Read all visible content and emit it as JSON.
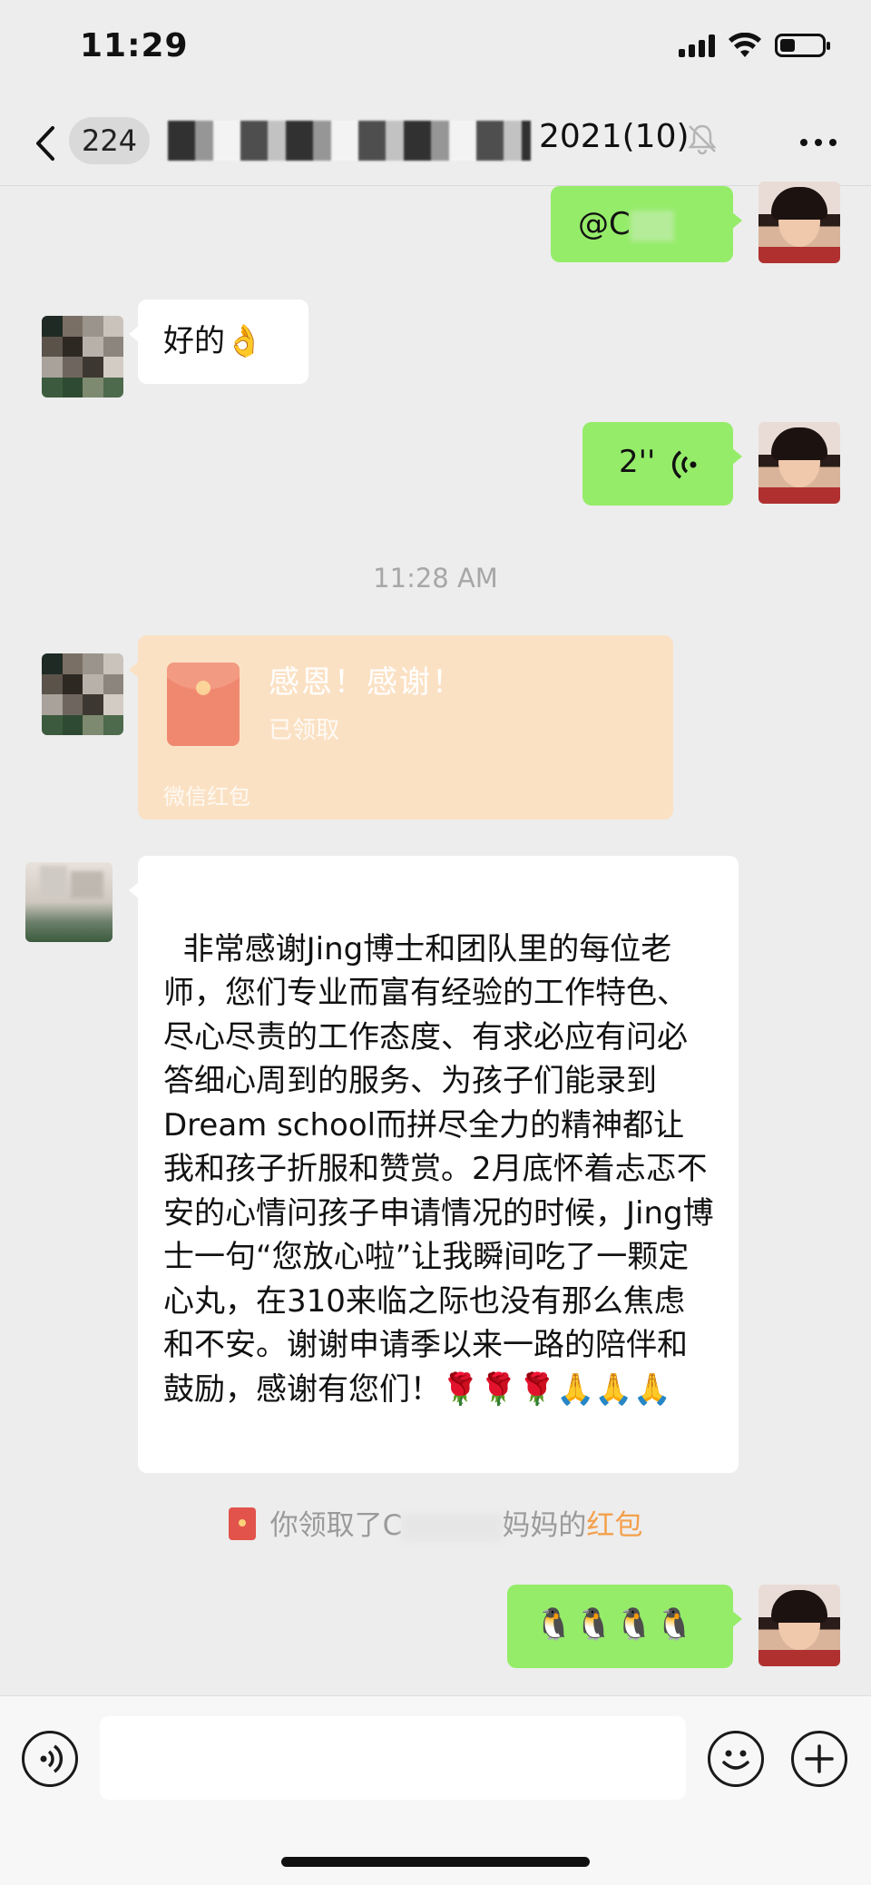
{
  "status_bar": {
    "time": "11:29"
  },
  "nav": {
    "unread_count": "224",
    "title": "2021(10)"
  },
  "messages": [
    {
      "sender": "me",
      "type": "text",
      "text": "@C"
    },
    {
      "sender": "other",
      "type": "text",
      "text": "好的👌"
    },
    {
      "sender": "me",
      "type": "voice",
      "duration": "2''"
    }
  ],
  "time_divider": "11:28 AM",
  "red_packet": {
    "greeting": "感恩！感谢！",
    "status": "已领取",
    "footer": "微信红包"
  },
  "long_message": {
    "text": "非常感谢Jing博士和团队里的每位老师，您们专业而富有经验的工作特色、尽心尽责的工作态度、有求必应有问必答细心周到的服务、为孩子们能录到Dream school而拼尽全力的精神都让我和孩子折服和赞赏。2月底怀着忐忑不安的心情问孩子申请情况的时候，Jing博士一句“您放心啦”让我瞬间吃了一颗定心丸，在310来临之际也没有那么焦虑和不安。谢谢申请季以来一路的陪伴和鼓励，感谢有您们！🌹🌹🌹🙏🙏🙏"
  },
  "system_note": {
    "prefix": "你领取了C",
    "suffix": "妈妈的",
    "link": "红包"
  },
  "last_message": {
    "sender": "me",
    "text": "🐧🐧🐧🐧"
  },
  "colors": {
    "background": "#ededed",
    "my_bubble": "#95ec69",
    "other_bubble": "#ffffff",
    "red_packet_received": "#fbe1c4",
    "red_packet_link": "#f4a04b"
  },
  "icons": [
    "back-icon",
    "mute-icon",
    "more-icon",
    "voice-wave-icon",
    "red-packet-icon",
    "voice-input-icon",
    "emoji-icon",
    "plus-icon"
  ]
}
